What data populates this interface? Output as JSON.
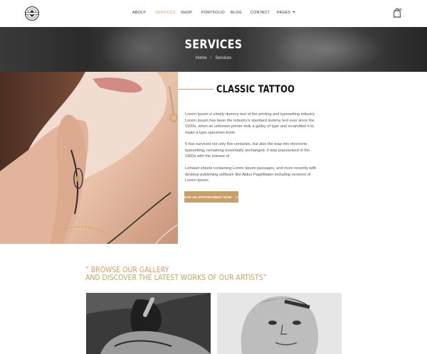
{
  "header": {
    "logo_icon": "tattoo-studio-logo",
    "nav": [
      {
        "label": "ABOUT",
        "active": false
      },
      {
        "label": "SERVICES",
        "active": true
      },
      {
        "label": "SHOP",
        "active": false
      },
      {
        "label": "PORTFOLIO",
        "active": false
      },
      {
        "label": "BLOG",
        "active": false
      },
      {
        "label": "CONTACT",
        "active": false
      },
      {
        "label": "PAGES",
        "active": false,
        "has_dropdown": true
      }
    ],
    "cart_icon": "shopping-bag-icon",
    "cart_badge_color": "#c9a069"
  },
  "hero": {
    "title": "SERVICES",
    "breadcrumb": {
      "home": "Home",
      "separator": "/",
      "current": "Services"
    }
  },
  "content": {
    "title": "CLASSIC TATTOO",
    "paragraphs": [
      "Lorem Ipsum is simply dummy text of the printing and typesetting industry. Lorem Ipsum has been the industry's standard dummy text ever since the 1500s, when an unknown printer took a galley of type and scrambled it to make a type specimen book.",
      "It has survived not only five centuries, but also the leap into electronic typesetting, remaining essentially unchanged. It was popularised in the 1960s with the release of",
      "Letraset sheets containing Lorem Ipsum passages, and more recently with desktop publishing software like Aldus PageMaker including versions of Lorem Ipsum."
    ],
    "button_label": "MAKE AN APPOINTMENT NOW",
    "button_icon": "arrow-right-icon"
  },
  "gallery": {
    "heading_line1": "“ BROWSE OUR GALLERY",
    "heading_line2": "AND DISCOVER THE LATEST WORKS OF OUR ARTISTS”"
  },
  "colors": {
    "accent": "#c9a069",
    "text": "#222222",
    "hero_overlay": "#2b2b2b"
  }
}
